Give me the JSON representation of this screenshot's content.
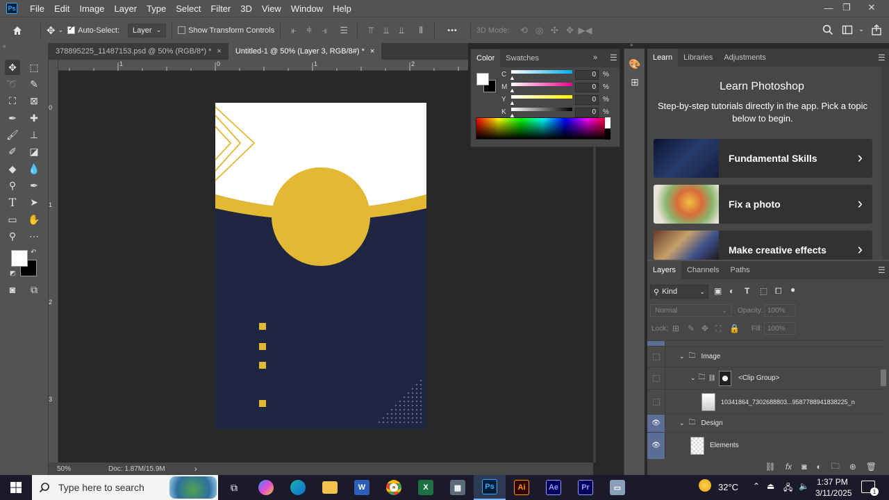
{
  "app": {
    "logo": "Ps"
  },
  "menu": [
    "File",
    "Edit",
    "Image",
    "Layer",
    "Type",
    "Select",
    "Filter",
    "3D",
    "View",
    "Window",
    "Help"
  ],
  "options": {
    "auto_select_label": "Auto-Select:",
    "auto_select_value": "Layer",
    "transform_label": "Show Transform Controls",
    "mode_label": "3D Mode:",
    "more": "•••"
  },
  "tabs": [
    {
      "label": "378895225_11487153.psd @ 50% (RGB/8*) *",
      "close": "×"
    },
    {
      "label": "Untitled-1 @ 50% (Layer 3, RGB/8#) *",
      "close": "×"
    }
  ],
  "ruler": {
    "top": [
      "1",
      "0",
      "1",
      "2"
    ],
    "left": [
      "0",
      "1",
      "2",
      "3"
    ]
  },
  "status": {
    "zoom": "50%",
    "doc": "Doc: 1.87M/15.9M",
    "arrow": "›"
  },
  "color_panel": {
    "tabs": [
      "Color",
      "Swatches"
    ],
    "channels": [
      {
        "label": "C",
        "value": "0",
        "unit": "%"
      },
      {
        "label": "M",
        "value": "0",
        "unit": "%"
      },
      {
        "label": "Y",
        "value": "0",
        "unit": "%"
      },
      {
        "label": "K",
        "value": "0",
        "unit": "%"
      }
    ]
  },
  "right_tabs": [
    "Learn",
    "Libraries",
    "Adjustments"
  ],
  "learn": {
    "title": "Learn Photoshop",
    "subtitle": "Step-by-step tutorials directly in the app. Pick a topic below to begin.",
    "cards": [
      {
        "label": "Fundamental Skills",
        "chev": "›"
      },
      {
        "label": "Fix a photo",
        "chev": "›"
      },
      {
        "label": "Make creative effects",
        "chev": "›"
      }
    ]
  },
  "layers_tabs": [
    "Layers",
    "Channels",
    "Paths"
  ],
  "layers": {
    "kind_label": "Kind",
    "blend_mode": "Normal",
    "opacity_label": "Opacity:",
    "opacity_value": "100%",
    "lock_label": "Lock:",
    "fill_label": "Fill:",
    "fill_value": "100%",
    "rows": [
      {
        "name": "Image"
      },
      {
        "name": "<Clip Group>"
      },
      {
        "name": "10341864_7302688803...9587788941838225_n"
      },
      {
        "name": "Design"
      },
      {
        "name": "Elements"
      }
    ]
  },
  "taskbar": {
    "search_placeholder": "Type here to search",
    "temp": "32°C",
    "time": "1:37 PM",
    "date": "3/11/2025",
    "notif": "1"
  },
  "colors": {
    "navy": "#1e2642",
    "gold": "#e3b832",
    "ps_blue": "#31a8ff",
    "panel": "#535353"
  }
}
